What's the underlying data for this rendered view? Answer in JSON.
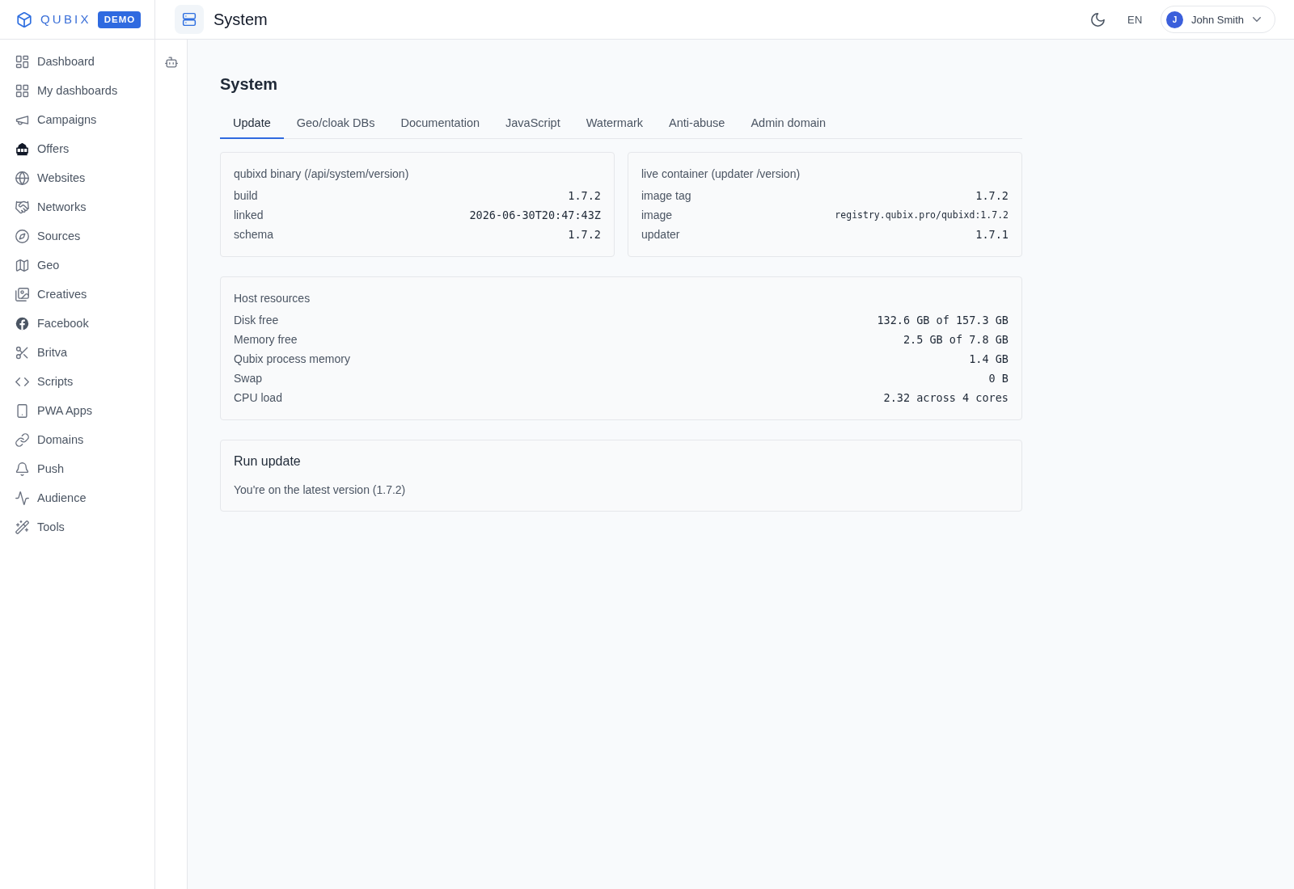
{
  "brand": {
    "name": "QUBIX",
    "badge": "DEMO"
  },
  "sidebar": {
    "items": [
      {
        "label": "Dashboard",
        "selected": false
      },
      {
        "label": "My dashboards",
        "selected": false
      },
      {
        "label": "Campaigns",
        "selected": false
      },
      {
        "label": "Offers",
        "selected": false
      },
      {
        "label": "Websites",
        "selected": false
      },
      {
        "label": "Networks",
        "selected": false
      },
      {
        "label": "Sources",
        "selected": false
      },
      {
        "label": "Geo",
        "selected": false
      },
      {
        "label": "Creatives",
        "selected": false
      },
      {
        "label": "Facebook",
        "selected": false
      },
      {
        "label": "Britva",
        "selected": false
      },
      {
        "label": "Scripts",
        "selected": false
      },
      {
        "label": "PWA Apps",
        "selected": false
      },
      {
        "label": "Domains",
        "selected": false
      },
      {
        "label": "Push",
        "selected": false
      },
      {
        "label": "Audience",
        "selected": false
      },
      {
        "label": "Tools",
        "selected": false
      }
    ]
  },
  "header": {
    "title": "System",
    "language": "EN",
    "user": {
      "initial": "J",
      "name": "John Smith"
    }
  },
  "page": {
    "title": "System",
    "tabs": [
      {
        "label": "Update",
        "selected": true
      },
      {
        "label": "Geo/cloak DBs",
        "selected": false
      },
      {
        "label": "Documentation",
        "selected": false
      },
      {
        "label": "JavaScript",
        "selected": false
      },
      {
        "label": "Watermark",
        "selected": false
      },
      {
        "label": "Anti-abuse",
        "selected": false
      },
      {
        "label": "Admin domain",
        "selected": false
      }
    ],
    "version_cards": [
      {
        "title": "qubixd binary (/api/system/version)",
        "rows": [
          {
            "label": "build",
            "value": "1.7.2"
          },
          {
            "label": "linked",
            "value": "2026-06-30T20:47:43Z"
          },
          {
            "label": "schema",
            "value": "1.7.2"
          }
        ]
      },
      {
        "title": "live container (updater /version)",
        "rows": [
          {
            "label": "image tag",
            "value": "1.7.2",
            "kind": "normal"
          },
          {
            "label": "image",
            "value": "registry.qubix.pro/qubixd:1.7.2",
            "kind": "compact"
          },
          {
            "label": "updater",
            "value": "1.7.1",
            "kind": "normal"
          }
        ]
      }
    ],
    "host_resources": {
      "title": "Host resources",
      "rows": [
        {
          "label": "Disk free",
          "value": "132.6 GB of 157.3 GB"
        },
        {
          "label": "Memory free",
          "value": "2.5 GB of 7.8 GB"
        },
        {
          "label": "Qubix process memory",
          "value": "1.4 GB"
        },
        {
          "label": "Swap",
          "value": "0 B"
        },
        {
          "label": "CPU load",
          "value": "2.32 across 4 cores"
        }
      ]
    },
    "run_update": {
      "title": "Run update",
      "message": "You're on the latest version (1.7.2)"
    }
  }
}
